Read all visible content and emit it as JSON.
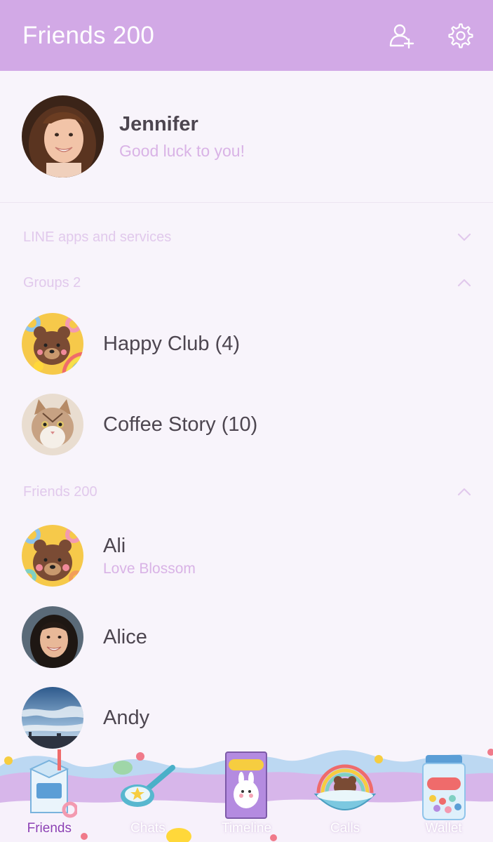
{
  "header": {
    "title": "Friends 200",
    "add_friend_icon": "add-friend-icon",
    "settings_icon": "gear-icon"
  },
  "profile": {
    "name": "Jennifer",
    "status": "Good luck to you!"
  },
  "sections": {
    "services": {
      "label": "LINE apps and services",
      "state": "collapsed"
    },
    "groups": {
      "label": "Groups 2",
      "state": "expanded"
    },
    "friends": {
      "label": "Friends 200",
      "state": "expanded"
    }
  },
  "groups": [
    {
      "name": "Happy Club (4)"
    },
    {
      "name": "Coffee Story (10)"
    }
  ],
  "friends": [
    {
      "name": "Ali",
      "status": "Love Blossom"
    },
    {
      "name": "Alice",
      "status": ""
    },
    {
      "name": "Andy",
      "status": ""
    }
  ],
  "tabs": [
    {
      "label": "Friends",
      "active": true
    },
    {
      "label": "Chats",
      "active": false
    },
    {
      "label": "Timeline",
      "active": false
    },
    {
      "label": "Calls",
      "active": false
    },
    {
      "label": "Wallet",
      "active": false
    }
  ],
  "colors": {
    "header": "#d2a9e6",
    "background": "#f8f4fb",
    "accent": "#8b3fb4",
    "muted": "#d9b3e6"
  }
}
